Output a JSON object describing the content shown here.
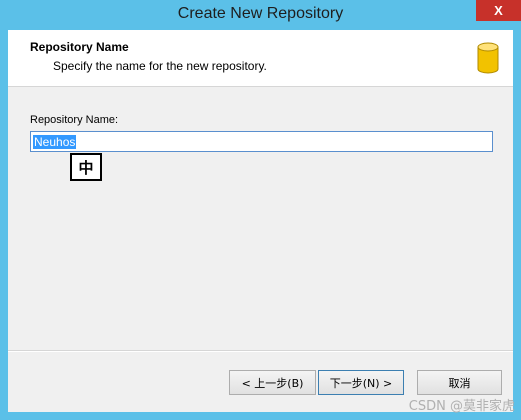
{
  "window": {
    "title": "Create New Repository",
    "close_glyph": "X"
  },
  "header": {
    "title": "Repository Name",
    "subtitle": "Specify the name for the new repository.",
    "icon": "database-icon"
  },
  "form": {
    "label": "Repository Name:",
    "value": "Neuhos",
    "ime_mode": "中"
  },
  "buttons": {
    "back": "< 上一步(B)",
    "next": "下一步(N) >",
    "cancel": "取消"
  },
  "watermark": "CSDN @莫非家虎",
  "colors": {
    "titlebar": "#5bc0e8",
    "close": "#c7312a",
    "selection": "#3399ff",
    "db_icon": "#f2c200"
  }
}
